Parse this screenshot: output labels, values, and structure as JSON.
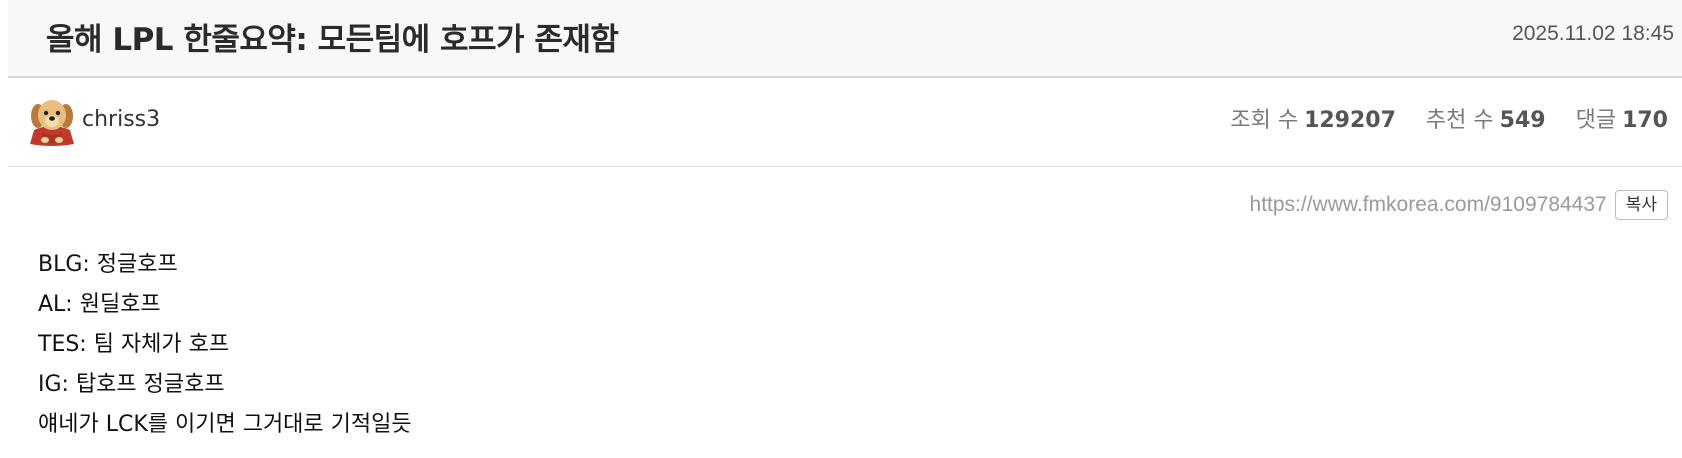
{
  "post": {
    "title": "올해 LPL 한줄요약: 모든팀에 호프가 존재함",
    "date": "2025.11.02 18:45",
    "author": "chriss3",
    "author_avatar": "puppy-avatar-icon",
    "stats": {
      "views_label": "조회 수",
      "views": "129207",
      "recommends_label": "추천 수",
      "recommends": "549",
      "comments_label": "댓글",
      "comments": "170"
    },
    "url": "https://www.fmkorea.com/9109784437",
    "copy_label": "복사",
    "body_lines": [
      "BLG: 정글호프",
      "AL: 원딜호프",
      "TES: 팀 자체가 호프",
      "IG: 탑호프 정글호프",
      "얘네가 LCK를 이기면 그거대로 기적일듯"
    ]
  }
}
